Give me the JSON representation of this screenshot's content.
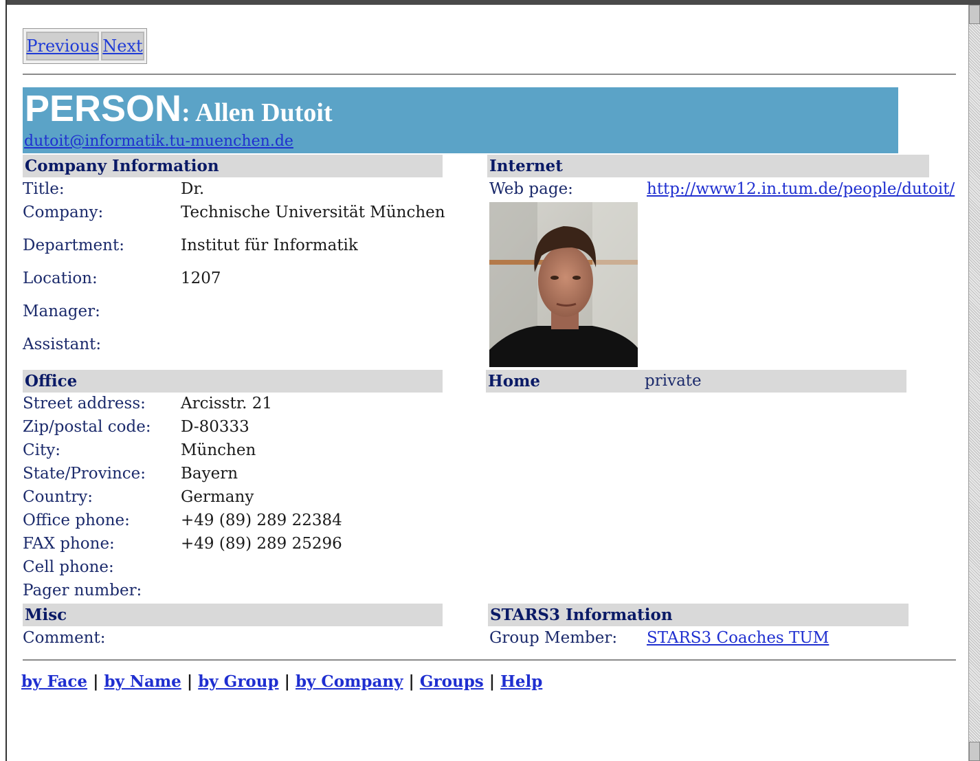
{
  "nav": {
    "previous": "Previous",
    "next": "Next"
  },
  "header": {
    "title_big": "PERSON",
    "title_name": ": Allen Dutoit",
    "email": "dutoit@informatik.tu-muenchen.de"
  },
  "company": {
    "heading": "Company Information",
    "rows": [
      {
        "label": "Title:",
        "value": "Dr."
      },
      {
        "label": "Company:",
        "value": "Technische Universität München"
      },
      {
        "label": "Department:",
        "value": "Institut für Informatik"
      },
      {
        "label": "Location:",
        "value": "1207"
      },
      {
        "label": "Manager:",
        "value": ""
      },
      {
        "label": "Assistant:",
        "value": ""
      }
    ]
  },
  "internet": {
    "heading": "Internet",
    "web_label": "Web page:",
    "web_url": "http://www12.in.tum.de/people/dutoit/"
  },
  "office": {
    "heading": "Office",
    "rows": [
      {
        "label": "Street address:",
        "value": "Arcisstr. 21"
      },
      {
        "label": "Zip/postal code:",
        "value": "D-80333"
      },
      {
        "label": "City:",
        "value": "München"
      },
      {
        "label": "State/Province:",
        "value": "Bayern"
      },
      {
        "label": "Country:",
        "value": "Germany"
      },
      {
        "label": "Office phone:",
        "value": "+49 (89) 289 22384"
      },
      {
        "label": "FAX phone:",
        "value": "+49 (89) 289 25296"
      },
      {
        "label": "Cell phone:",
        "value": ""
      },
      {
        "label": "Pager number:",
        "value": ""
      }
    ]
  },
  "home": {
    "heading": "Home",
    "value": "private"
  },
  "misc": {
    "heading": "Misc",
    "comment_label": "Comment:"
  },
  "stars": {
    "heading": "STARS3 Information",
    "group_label": "Group Member:",
    "group_value": "STARS3 Coaches TUM"
  },
  "footer": {
    "links": [
      "by Face",
      "by Name",
      "by Group",
      "by Company",
      "Groups",
      "Help"
    ],
    "separator": " | "
  }
}
